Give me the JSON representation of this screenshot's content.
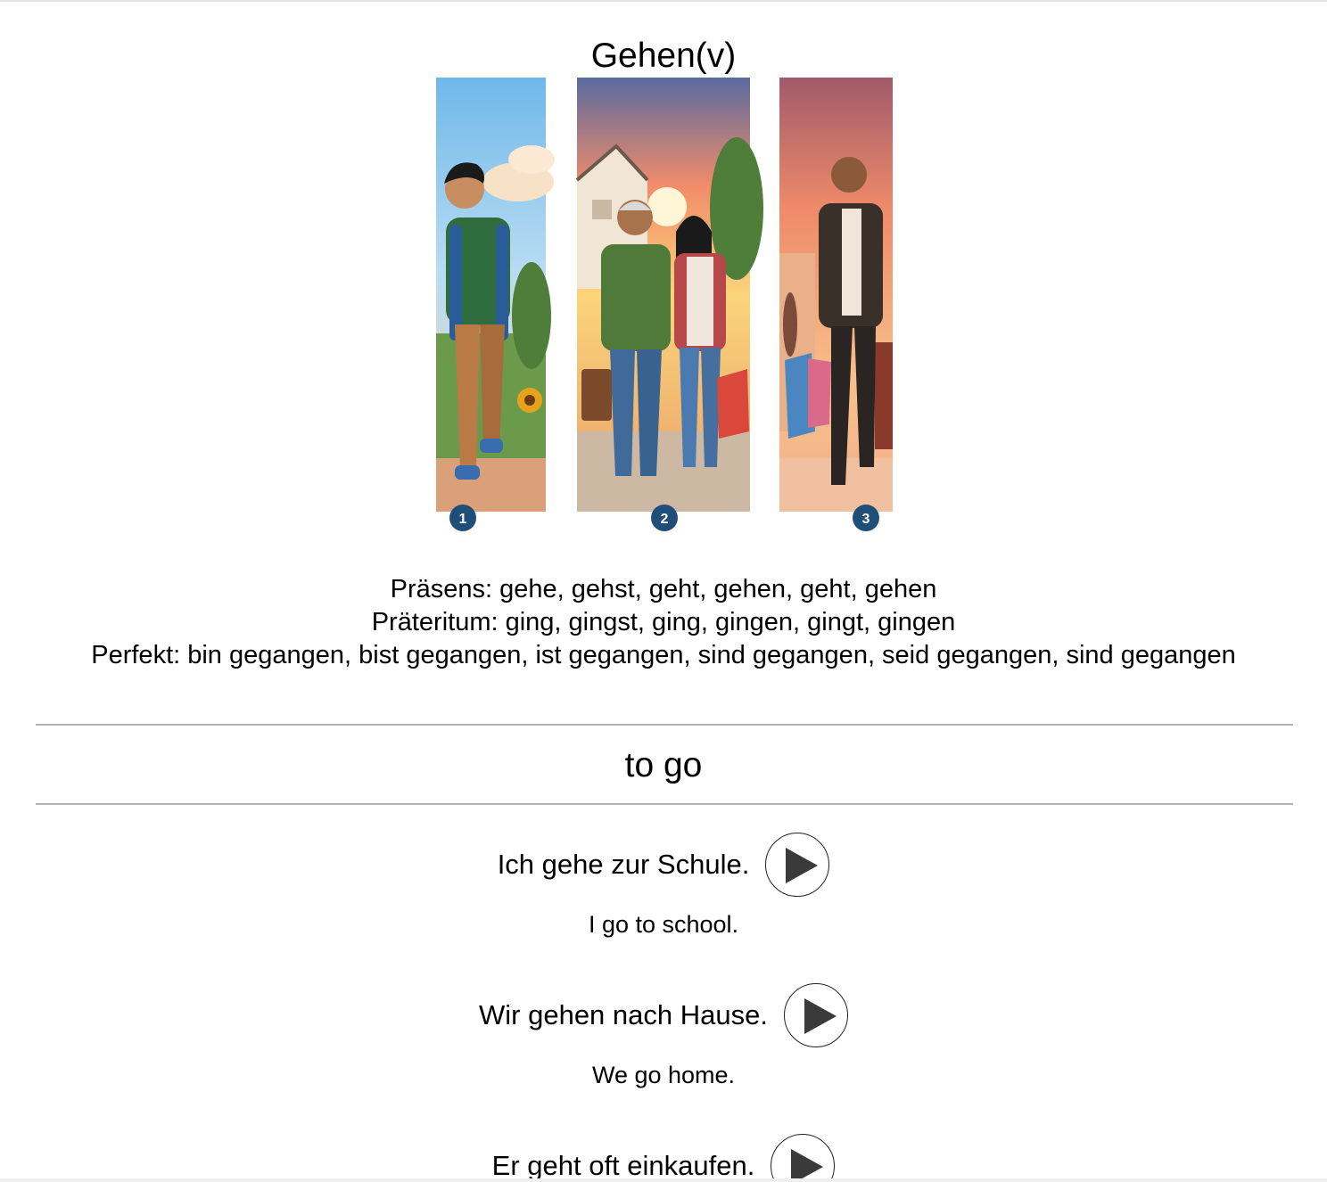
{
  "word": {
    "title": "Gehen(v)",
    "translation": "to go"
  },
  "illustration": {
    "panels": [
      {
        "badge": "1"
      },
      {
        "badge": "2"
      },
      {
        "badge": "3"
      }
    ],
    "colors": {
      "badge": "#1f4e79",
      "sky1": "#8ecbef",
      "sky2": "#f39a6a",
      "sky3": "#e9876a"
    }
  },
  "conjugation": {
    "praesens": "Präsens: gehe, gehst, geht, gehen, geht, gehen",
    "praeteritum": "Präteritum: ging, gingst, ging, gingen, gingt, gingen",
    "perfekt": "Perfekt: bin gegangen, bist gegangen, ist gegangen, sind gegangen, seid gegangen, sind gegangen"
  },
  "examples": [
    {
      "de": "Ich gehe zur Schule.",
      "en": "I go to school.",
      "icon": "play-icon"
    },
    {
      "de": "Wir gehen nach Hause.",
      "en": "We go home.",
      "icon": "play-icon"
    },
    {
      "de": "Er geht oft einkaufen.",
      "en": "",
      "icon": "play-icon"
    }
  ]
}
